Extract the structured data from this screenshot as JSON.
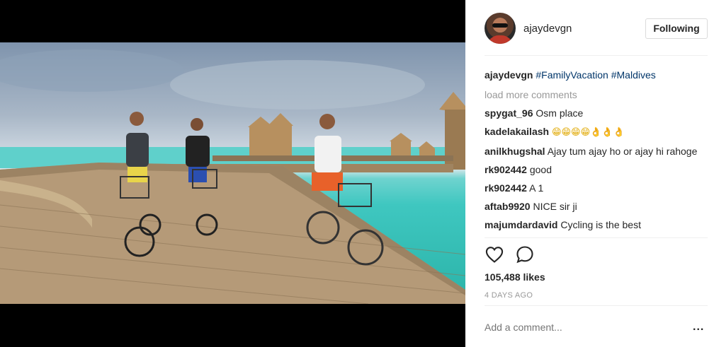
{
  "post": {
    "username": "ajaydevgn",
    "follow_label": "Following",
    "caption": {
      "username": "ajaydevgn",
      "hashtags": [
        "#FamilyVacation",
        "#Maldives"
      ]
    },
    "load_more": "load more comments",
    "comments": [
      {
        "user": "spygat_96",
        "text": "Osm place"
      },
      {
        "user": "kadelakailash",
        "text": "😁😁😁😁👌👌👌"
      },
      {
        "user": "anilkhugshal",
        "text": "Ajay tum ajay ho or ajay hi rahoge"
      },
      {
        "user": "rk902442",
        "text": "good"
      },
      {
        "user": "rk902442",
        "text": "A 1"
      },
      {
        "user": "aftab9920",
        "text": "NICE sir ji"
      },
      {
        "user": "majumdardavid",
        "text": "Cycling is the best"
      }
    ],
    "likes": "105,488 likes",
    "time": "4 DAYS AGO",
    "add_comment_placeholder": "Add a comment...",
    "more_options": "..."
  },
  "icons": {
    "like": "heart-icon",
    "comment": "speech-bubble-icon",
    "more": "more-options-icon"
  },
  "colors": {
    "hashtag": "#003569",
    "muted": "#999999",
    "border": "#dbdbdb"
  }
}
